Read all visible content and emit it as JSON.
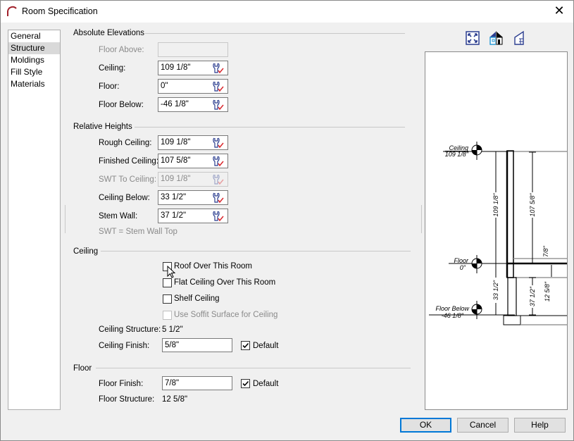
{
  "window": {
    "title": "Room Specification",
    "close": "✕"
  },
  "sidebar": {
    "items": [
      {
        "label": "General"
      },
      {
        "label": "Structure",
        "selected": true
      },
      {
        "label": "Moldings"
      },
      {
        "label": "Fill Style"
      },
      {
        "label": "Materials"
      }
    ]
  },
  "absolute": {
    "header": "Absolute Elevations",
    "floor_above": {
      "label": "Floor Above:",
      "value": ""
    },
    "ceiling": {
      "label": "Ceiling:",
      "value": "109 1/8\""
    },
    "floor": {
      "label": "Floor:",
      "value": "0\""
    },
    "floor_below": {
      "label": "Floor Below:",
      "value": "-46 1/8\""
    }
  },
  "relative": {
    "header": "Relative Heights",
    "rough_ceiling": {
      "label": "Rough Ceiling:",
      "value": "109 1/8\""
    },
    "finished_ceiling": {
      "label": "Finished Ceiling:",
      "value": "107 5/8\""
    },
    "swt_to_ceiling": {
      "label": "SWT To Ceiling:",
      "value": "109 1/8\""
    },
    "ceiling_below": {
      "label": "Ceiling Below:",
      "value": "33 1/2\""
    },
    "stem_wall": {
      "label": "Stem Wall:",
      "value": "37 1/2\""
    },
    "note": "SWT = Stem Wall Top"
  },
  "ceiling": {
    "header": "Ceiling",
    "roof_over": {
      "label": "Roof Over This Room",
      "checked": false
    },
    "flat_ceiling": {
      "label": "Flat Ceiling Over This Room",
      "checked": false
    },
    "shelf_ceiling": {
      "label": "Shelf Ceiling",
      "checked": false
    },
    "soffit": {
      "label": "Use Soffit Surface for Ceiling",
      "checked": false,
      "disabled": true
    },
    "structure_label": "Ceiling Structure:",
    "structure_value": "5 1/2\"",
    "finish_label": "Ceiling Finish:",
    "finish_value": "5/8\"",
    "default_label": "Default",
    "default_checked": true
  },
  "floor": {
    "header": "Floor",
    "finish_label": "Floor Finish:",
    "finish_value": "7/8\"",
    "default_label": "Default",
    "default_checked": true,
    "structure_label": "Floor Structure:",
    "structure_value": "12 5/8\""
  },
  "preview": {
    "icons": [
      "fit-view-icon",
      "3d-view-icon",
      "elevation-view-icon"
    ],
    "labels": {
      "ceiling": "Ceiling",
      "ceiling_val": "109 1/8\"",
      "floor": "Floor",
      "floor_val": "0\"",
      "floor_below": "Floor Below",
      "floor_below_val": "-46 1/8\"",
      "dim_rough": "109 1/8\"",
      "dim_finished": "107 5/8\"",
      "dim_floor_finish": "7/8\"",
      "dim_floor_structure": "12 5/8\"",
      "dim_ceiling_below": "33 1/2\"",
      "dim_stem": "37 1/2\""
    }
  },
  "buttons": {
    "ok": "OK",
    "cancel": "Cancel",
    "help": "Help"
  },
  "colors": {
    "accent": "#0078d7",
    "icon_blue": "#2b3d8f",
    "check_red": "#d9262b"
  }
}
